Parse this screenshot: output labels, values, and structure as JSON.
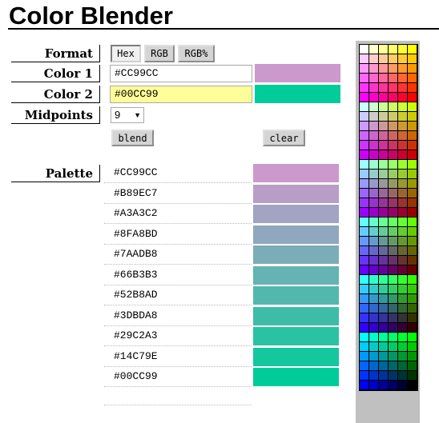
{
  "title": "Color Blender",
  "labels": {
    "format": "Format",
    "color1": "Color 1",
    "color2": "Color 2",
    "midpoints": "Midpoints",
    "palette": "Palette"
  },
  "format_buttons": [
    {
      "label": "Hex",
      "selected": true
    },
    {
      "label": "RGB",
      "selected": false
    },
    {
      "label": "RGB%",
      "selected": false
    }
  ],
  "color1": {
    "value": "#CC99CC",
    "swatch": "#CC99CC"
  },
  "color2": {
    "value": "#00CC99",
    "swatch": "#00CC99"
  },
  "midpoints": {
    "selected": "9"
  },
  "actions": {
    "blend": "blend",
    "clear": "clear"
  },
  "palette": [
    "#CC99CC",
    "#B89EC7",
    "#A3A3C2",
    "#8FA8BD",
    "#7AADB8",
    "#66B3B3",
    "#52B8AD",
    "#3DBDA8",
    "#29C2A3",
    "#14C79E",
    "#00CC99"
  ],
  "picker": {
    "levels": [
      "FF",
      "CC",
      "99",
      "66",
      "33",
      "00"
    ]
  }
}
